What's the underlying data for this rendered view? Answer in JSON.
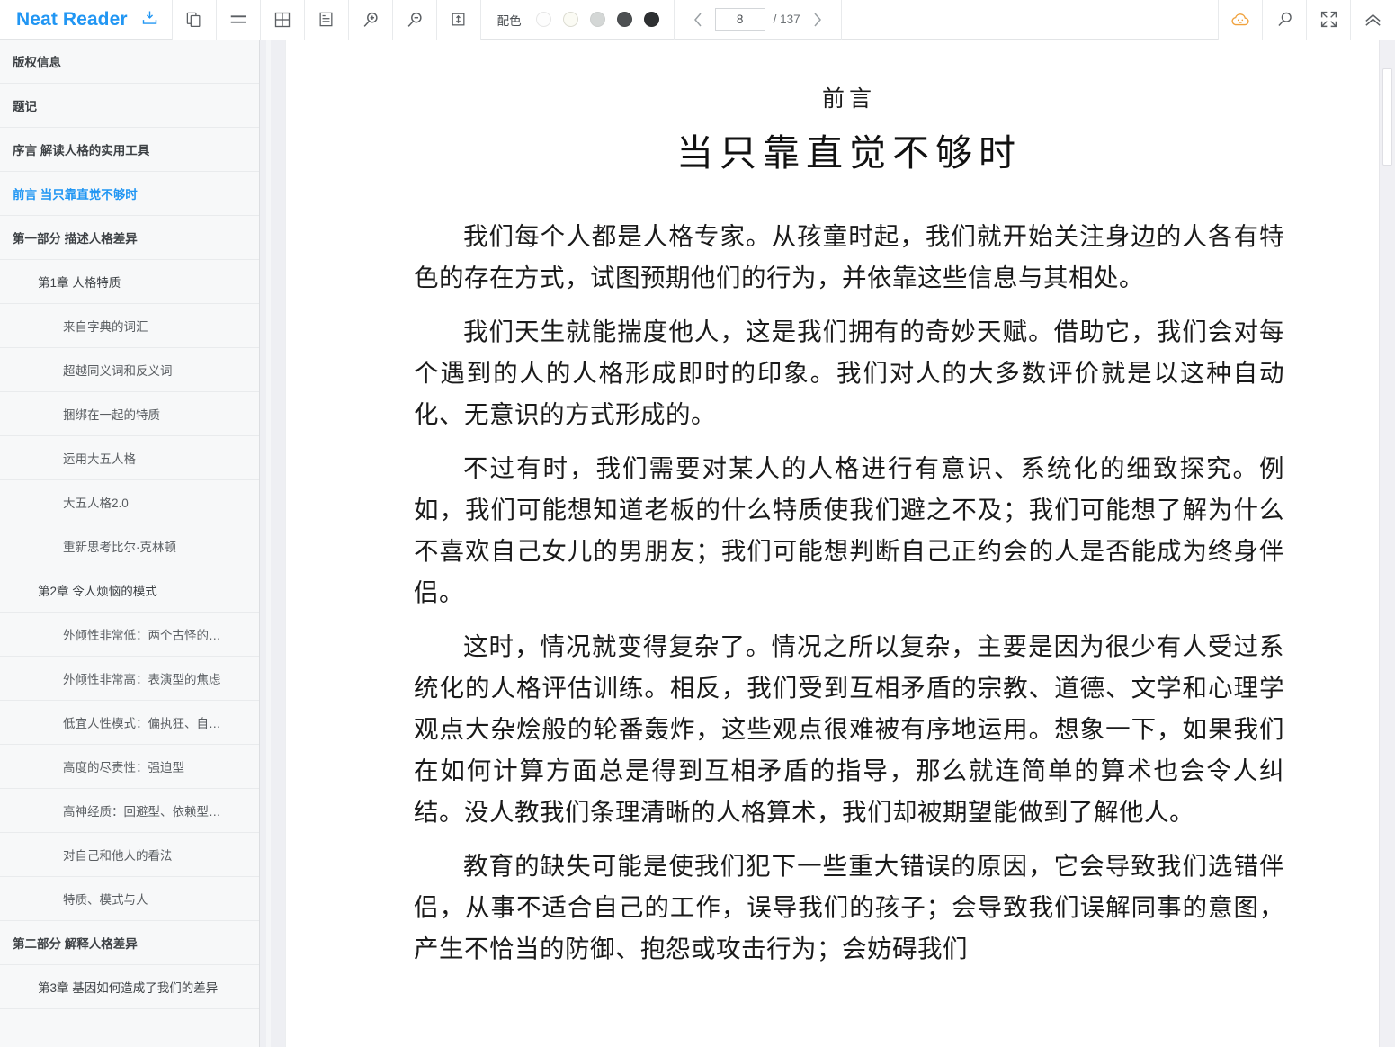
{
  "app": {
    "brand": "Neat Reader",
    "brand_color": "#2196f3"
  },
  "toolbar": {
    "icons": [
      {
        "name": "save-to-library-icon",
        "title": "保存"
      },
      {
        "name": "copy-pages-icon",
        "title": "双页"
      },
      {
        "name": "menu-lines-icon",
        "title": "目录"
      },
      {
        "name": "grid-layout-icon",
        "title": "网格"
      },
      {
        "name": "page-layout-icon",
        "title": "排版"
      },
      {
        "name": "zoom-in-icon",
        "title": "放大"
      },
      {
        "name": "zoom-out-icon",
        "title": "缩小"
      },
      {
        "name": "line-height-icon",
        "title": "行距"
      }
    ],
    "color_scheme": {
      "label": "配色",
      "swatches": [
        {
          "name": "swatch-white",
          "color": "#fdfdfd",
          "border": "#e6e6e6",
          "selected": false
        },
        {
          "name": "swatch-cream",
          "color": "#fbfbf4",
          "border": "#dcdcd2",
          "selected": false
        },
        {
          "name": "swatch-light-gray",
          "color": "#d4d7d6",
          "border": "#cbcecd",
          "selected": false
        },
        {
          "name": "swatch-dark-gray",
          "color": "#4d5052",
          "border": "#45484a",
          "selected": false
        },
        {
          "name": "swatch-black",
          "color": "#2e3032",
          "border": "#2a2c2e",
          "selected": false
        }
      ]
    },
    "pager": {
      "prev_label": "‹",
      "next_label": "›",
      "current_page": "8",
      "total_label": "/ 137"
    },
    "right_icons": [
      {
        "name": "cloud-sync-icon",
        "title": "云同步",
        "color": "#f0a13c"
      },
      {
        "name": "search-icon",
        "title": "搜索",
        "color": "#5b5f63"
      },
      {
        "name": "collapse-arrows-icon",
        "title": "全屏",
        "color": "#5b5f63"
      },
      {
        "name": "chevron-double-up-icon",
        "title": "收起工具栏",
        "color": "#5b5f63"
      }
    ]
  },
  "sidebar": {
    "items": [
      {
        "label": "版权信息",
        "level": 0,
        "active": false
      },
      {
        "label": "题记",
        "level": 0,
        "active": false
      },
      {
        "label": "序言 解读人格的实用工具",
        "level": 0,
        "active": false
      },
      {
        "label": "前言 当只靠直觉不够时",
        "level": 0,
        "active": true
      },
      {
        "label": "第一部分 描述人格差异",
        "level": 0,
        "active": false
      },
      {
        "label": "第1章 人格特质",
        "level": 1,
        "active": false
      },
      {
        "label": "来自字典的词汇",
        "level": 2,
        "active": false
      },
      {
        "label": "超越同义词和反义词",
        "level": 2,
        "active": false
      },
      {
        "label": "捆绑在一起的特质",
        "level": 2,
        "active": false
      },
      {
        "label": "运用大五人格",
        "level": 2,
        "active": false
      },
      {
        "label": "大五人格2.0",
        "level": 2,
        "active": false
      },
      {
        "label": "重新思考比尔·克林顿",
        "level": 2,
        "active": false
      },
      {
        "label": "第2章 令人烦恼的模式",
        "level": 1,
        "active": false
      },
      {
        "label": "外倾性非常低：两个古怪的…",
        "level": 2,
        "active": false
      },
      {
        "label": "外倾性非常高：表演型的焦虑",
        "level": 2,
        "active": false
      },
      {
        "label": "低宜人性模式：偏执狂、自…",
        "level": 2,
        "active": false
      },
      {
        "label": "高度的尽责性：强迫型",
        "level": 2,
        "active": false
      },
      {
        "label": "高神经质：回避型、依赖型…",
        "level": 2,
        "active": false
      },
      {
        "label": "对自己和他人的看法",
        "level": 2,
        "active": false
      },
      {
        "label": "特质、模式与人",
        "level": 2,
        "active": false
      },
      {
        "label": "第二部分 解释人格差异",
        "level": 0,
        "active": false
      },
      {
        "label": "第3章 基因如何造成了我们的差异",
        "level": 1,
        "active": false
      }
    ]
  },
  "content": {
    "kicker": "前言",
    "title": "当只靠直觉不够时",
    "paragraphs": [
      "我们每个人都是人格专家。从孩童时起，我们就开始关注身边的人各有特色的存在方式，试图预期他们的行为，并依靠这些信息与其相处。",
      "我们天生就能揣度他人，这是我们拥有的奇妙天赋。借助它，我们会对每个遇到的人的人格形成即时的印象。我们对人的大多数评价就是以这种自动化、无意识的方式形成的。",
      "不过有时，我们需要对某人的人格进行有意识、系统化的细致探究。例如，我们可能想知道老板的什么特质使我们避之不及；我们可能想了解为什么不喜欢自己女儿的男朋友；我们可能想判断自己正约会的人是否能成为终身伴侣。",
      "这时，情况就变得复杂了。情况之所以复杂，主要是因为很少有人受过系统化的人格评估训练。相反，我们受到互相矛盾的宗教、道德、文学和心理学观点大杂烩般的轮番轰炸，这些观点很难被有序地运用。想象一下，如果我们在如何计算方面总是得到互相矛盾的指导，那么就连简单的算术也会令人纠结。没人教我们条理清晰的人格算术，我们却被期望能做到了解他人。",
      "教育的缺失可能是使我们犯下一些重大错误的原因，它会导致我们选错伴侣，从事不适合自己的工作，误导我们的孩子；会导致我们误解同事的意图，产生不恰当的防御、抱怨或攻击行为；会妨碍我们"
    ]
  }
}
